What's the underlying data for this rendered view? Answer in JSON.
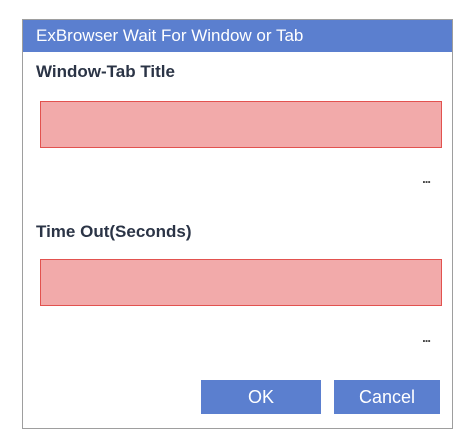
{
  "dialog": {
    "title": "ExBrowser Wait For Window or Tab"
  },
  "fields": [
    {
      "label": "Window-Tab Title",
      "value": "",
      "ellipsis": "..."
    },
    {
      "label": "Time Out(Seconds)",
      "value": "",
      "ellipsis": "..."
    }
  ],
  "buttons": {
    "ok_label": "OK",
    "cancel_label": "Cancel"
  },
  "colors": {
    "accent": "#5b7fcf",
    "invalid_fill": "#f2aaaa",
    "invalid_border": "#e2524f"
  }
}
